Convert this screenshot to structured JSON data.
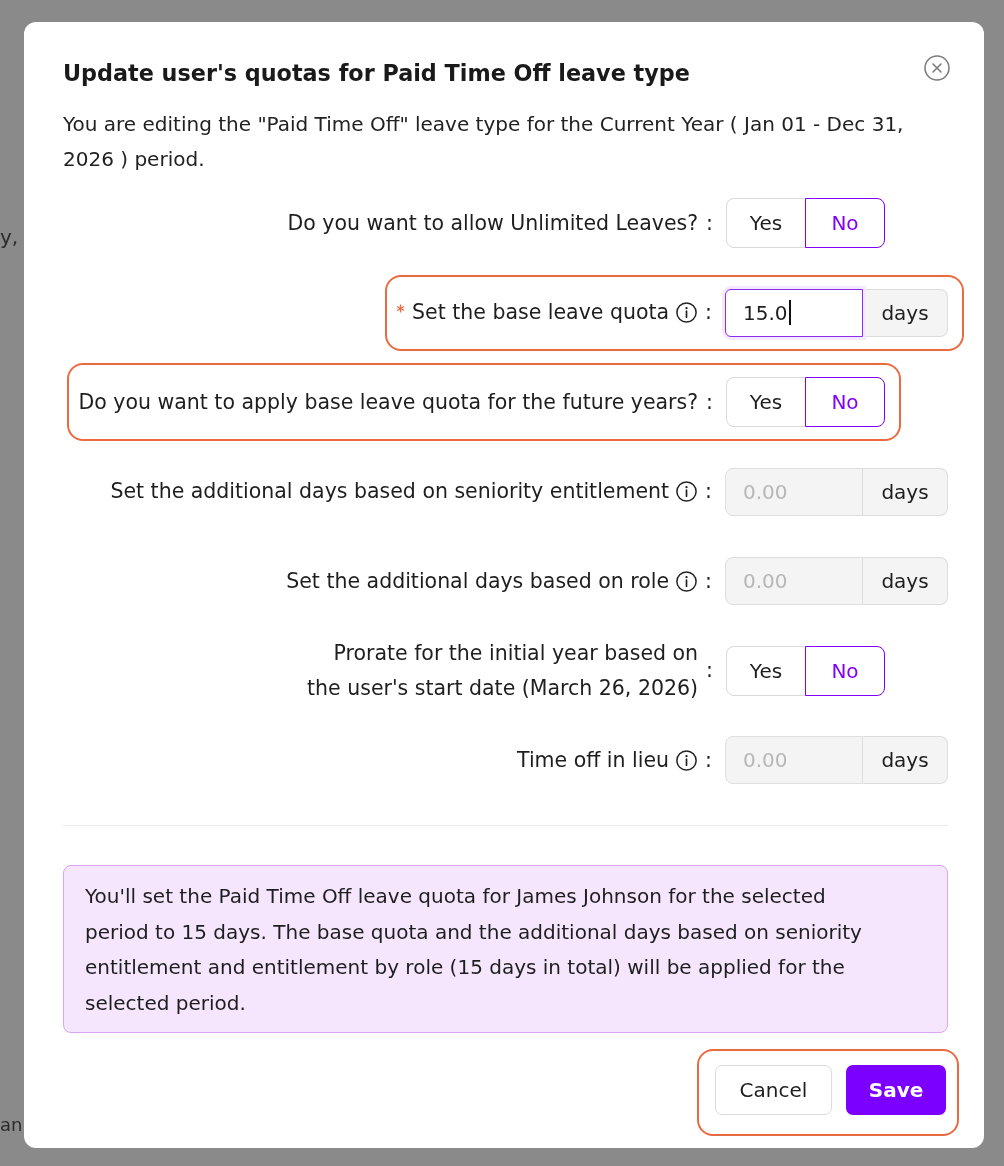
{
  "backdrop": {
    "texts": [
      "y,",
      "an"
    ]
  },
  "dialog": {
    "title": "Update user's quotas for Paid Time Off leave type",
    "description": "You are editing the \"Paid Time Off\" leave type for the Current Year ( Jan 01 - Dec 31, 2026 ) period."
  },
  "fields": [
    {
      "kind": "toggle",
      "label": "Do you want to allow Unlimited Leaves?",
      "colon": ":",
      "required": false,
      "info": false,
      "highlighted": false,
      "options": [
        {
          "label": "Yes",
          "selected": false
        },
        {
          "label": "No",
          "selected": true
        }
      ]
    },
    {
      "kind": "number",
      "label": "Set the base leave quota",
      "colon": ":",
      "required": true,
      "info": true,
      "highlighted": true,
      "value": "15.0",
      "unit": "days",
      "disabled": false,
      "focused": true
    },
    {
      "kind": "toggle",
      "label": "Do you want to apply base leave quota for the future years?",
      "colon": ":",
      "required": false,
      "info": false,
      "highlighted": true,
      "options": [
        {
          "label": "Yes",
          "selected": false
        },
        {
          "label": "No",
          "selected": true
        }
      ]
    },
    {
      "kind": "number",
      "label": "Set the additional days based on seniority entitlement",
      "colon": ":",
      "required": false,
      "info": true,
      "highlighted": false,
      "placeholder": "0.00",
      "unit": "days",
      "disabled": true,
      "focused": false
    },
    {
      "kind": "number",
      "label": "Set the additional days based on role",
      "colon": ":",
      "required": false,
      "info": true,
      "highlighted": false,
      "placeholder": "0.00",
      "unit": "days",
      "disabled": true,
      "focused": false
    },
    {
      "kind": "toggle",
      "label": "Prorate for the initial year based on\nthe user's start date (March 26, 2026)",
      "colon": ":",
      "required": false,
      "info": false,
      "highlighted": false,
      "options": [
        {
          "label": "Yes",
          "selected": false
        },
        {
          "label": "No",
          "selected": true
        }
      ]
    },
    {
      "kind": "number",
      "label": "Time off in lieu",
      "colon": ":",
      "required": false,
      "info": true,
      "highlighted": false,
      "placeholder": "0.00",
      "unit": "days",
      "disabled": true,
      "focused": false
    }
  ],
  "summary": "You'll set the Paid Time Off leave quota for James Johnson for the selected period to 15 days. The base quota and the additional days based on seniority entitlement and entitlement by role (15 days in total) will be applied for the selected period.",
  "footer": {
    "highlighted": true,
    "buttons": [
      {
        "kind": "secondary",
        "label": "Cancel"
      },
      {
        "kind": "primary",
        "label": "Save"
      }
    ]
  }
}
